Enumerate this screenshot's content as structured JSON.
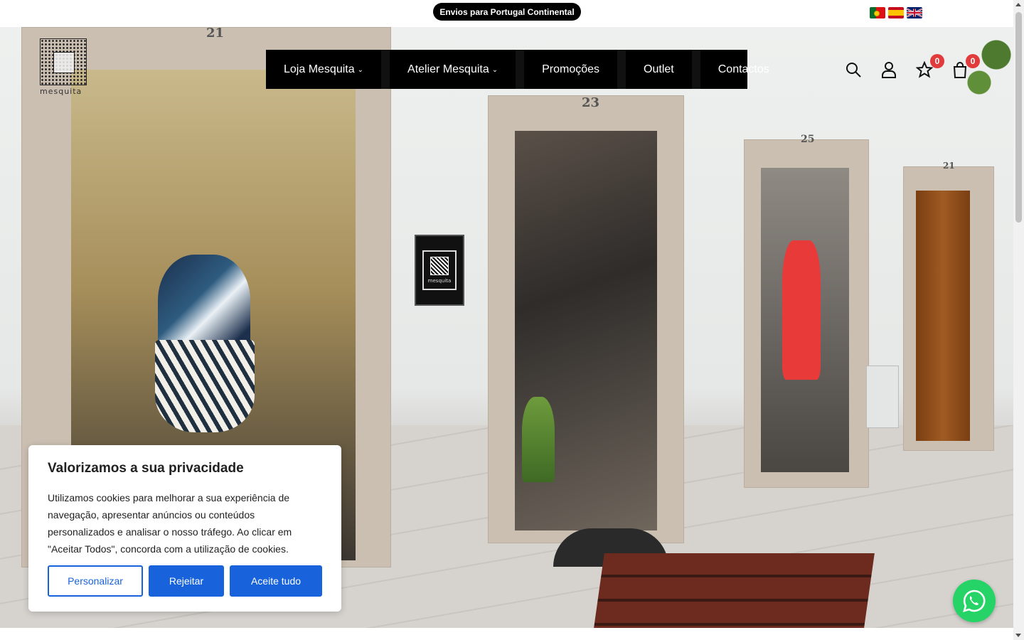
{
  "topbar": {
    "shipping_text": "Envios para Portugal Continental",
    "languages": [
      "pt-flag-icon",
      "es-flag-icon",
      "gb-flag-icon"
    ]
  },
  "logo": {
    "text": "mesquita"
  },
  "nav": {
    "items": [
      {
        "label": "Loja Mesquita",
        "has_dropdown": true
      },
      {
        "label": "Atelier Mesquita",
        "has_dropdown": true
      },
      {
        "label": "Promoções",
        "has_dropdown": false
      },
      {
        "label": "Outlet",
        "has_dropdown": false
      },
      {
        "label": "Contactos",
        "has_dropdown": false
      }
    ],
    "dropdown_glyph": "⌄"
  },
  "header_icons": {
    "wishlist_count": "0",
    "cart_count": "0"
  },
  "hero": {
    "door_numbers": [
      "21",
      "23",
      "25",
      "21"
    ]
  },
  "cookie": {
    "title": "Valorizamos a sua privacidade",
    "text": "Utilizamos cookies para melhorar a sua experiência de navegação, apresentar anúncios ou conteúdos personalizados e analisar o nosso tráfego. Ao clicar em \"Aceitar Todos\", concorda com a utilização de cookies.",
    "customize_label": "Personalizar",
    "reject_label": "Rejeitar",
    "accept_label": "Aceite tudo"
  },
  "colors": {
    "accent": "#1863dc",
    "badge": "#e23b3b",
    "whatsapp": "#25d366",
    "nav_bg": "#000000"
  }
}
